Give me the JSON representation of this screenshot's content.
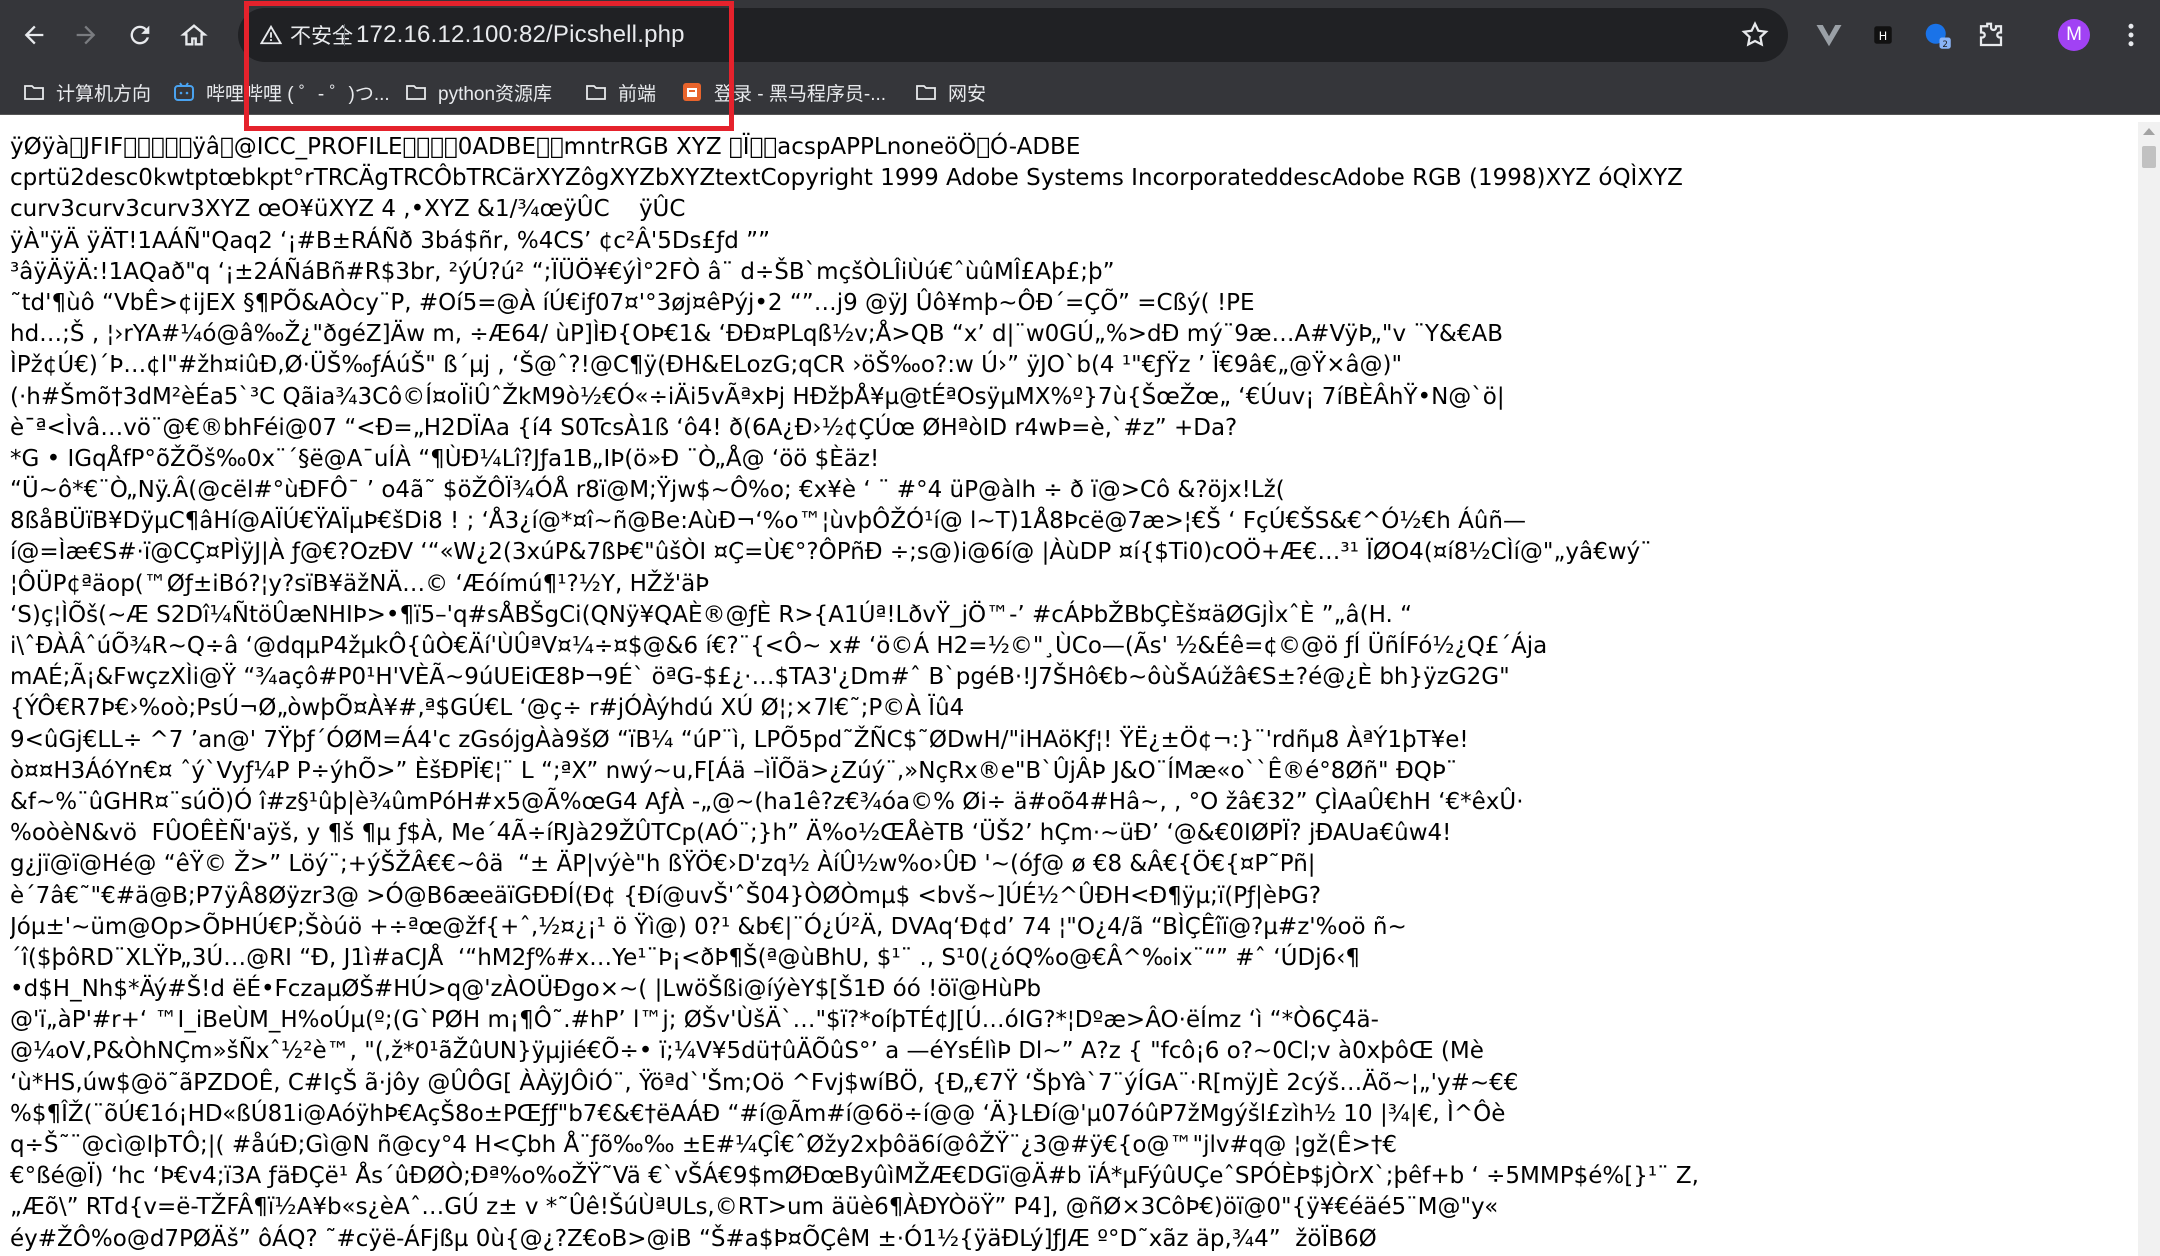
{
  "browser": {
    "security_label": "不安全",
    "url": "172.16.12.100:82/Picshell.php",
    "avatar_letter": "M",
    "accent_highlight": "#e5222c",
    "ext_badge": "2"
  },
  "bookmarks": [
    {
      "label": "计算机方向",
      "icon": "folder-icon"
    },
    {
      "label": "哔哩哔哩 ( ゜- ゜)つ...",
      "icon": "bilibili-icon"
    },
    {
      "label": "python资源库",
      "icon": "folder-icon"
    },
    {
      "label": "前端",
      "icon": "folder-icon"
    },
    {
      "label": "登录 - 黑马程序员-...",
      "icon": "site-favicon-icon"
    },
    {
      "label": "网安",
      "icon": "folder-icon"
    }
  ],
  "content_lines": [
    "ÿØÿà\u0000JFIF\u0000\u0001\u0002\u0000\u0000ÿâ\u0002@ICC_PROFILE\u0000\u0001\u0001\u00000ADBE\u0002\u0010mntrRGB XYZ \u0007Ï\u0000\u0006acspAPPLnoneöÖ\u0000Ó-ADBE",
    "cprtü2desc\u0001\u00000kwtpt\u0001œ\u0014bkpt\u0001°\u0014rTRC\u0001Ä\u000egTRC\u0001Ô\u000ebTRC\u0001ä\u000erXYZ\u0001ô\u0014gXYZ\u0002\b\u0014bXYZ\u0002\u001c\u0014textCopyright 1999 Adobe Systems Incorporateddesc\u0011Adobe RGB (1998)XYZ óQ\u0001\u0001\u0016ÌXYZ",
    "curv\u0001\u00023curv\u0001\u00023curv\u0001\u00023XYZ œ\u0018O¥\u0004üXYZ 4\u0019 ,\u0007•XYZ &1\u0010/¾œÿÛC\u0001\u0001\u0001\u0001\u0001\u0001\u0001\u0001\u0001\u0001\u0001\u0001\u0001\u0001\u0001\u0001\u0001\u0001\u0001\u0001\u0001\u0001\u0001\u0001 \u0001\u0001\u0001\u0001\u0001\u0001\u0001\u0001 \u0001\u0001\u0001\u0001\u0001\u0001 \u0001 ÿÛC\u0001\u0001\u0001\u0001\u0001\u0001\u0001\u0001\u0001\u0001\u0001\u0001 \u0001\u0001\u0001",
    "ÿÀ\u0011\u0002\u0010\u0003\u0001\"\u0002\u0011\u0001\u0003\u0011\u0001ÿÄ\u001f\u0001\u0001\u0001\u0001\u0001\u0001\u0001\u0001\u0001\u0001\u0001\u0001\u0001\u0001\u0001 ÿÄT\u0001\u0001\u0001\u0001\u0001\u0001\u0001\u0001\u0001\u0001\u0001\u0001\u0001\u0001\u0001\u0001\u0001\u0001\u0001\u0001\u0001\u0001\u0001\u0001\u0001\u0001\u0001\u0001\u0001\u0001\u0001!1A\u0002ÁÑ\"Q\u0003aq\u0013\u00072 ‘¡\u0014#B±RÁÑð \u00153bá$ñ\u0004r, %4CS’ ¢\u0010c²Â\u0010'5Ds£ƒd ””",
    "³âÿÄ\u001f\u0001\u0001\u0001\u0001\u0001\u0001\u0001\u0001\u0001\u0001\u0001\u0001\u0001\u0001\u0001ÿÄ:\u0011\u0001\u0001\u0001\u0001\u0001\u0001\u0001\u0001\u0001\u0001\u0001\u0001\u0001\u0001\u0001\u0001\u0001!\u00011A\u0002\u0011Qað\u0013\u0003\"q\u0012 ‘¡±\u0011\u00142ÁÑá\u0015Bñ#R\u0003\u0016$3br, ²ýÚ\u0001\u0001\u0001\u0001\u0001\u0001\u0001\u0001?ú² “;ÏÜÖ¥€ýÌ\u0003°2FÒ\u0001\u0001 â¨ d÷ŠB`mçšÒLÎ\u0002iÙú€ˆùûMÎ\u0001£Aþ£;þ”",
    "˜td'¶ùô “VbÊ>¢\u0001\u0001\u0016ijEX\u0001\u0001 §¶PÕ\u0001&AÒcy¨P, #Oí5=@À\u0001 íÚ€iƒ07¤'°\u0001\u0001\u00063\u0001øj\u0001¤\u0001êPýj•\u0001\u00012 “”…\u0001j9 @ÿJ\u0001 \u0001Ûô¥\u0001mþ~ÔÐ´\u0001=ÇÕ” =Cßý(\u0001 !PE",
    "hd…\u0001;Š\u0001 , \u0001¦›rYA#¼ó@â‰Ž¿\u0001\"\u0001\u0001ðgéZ]Ä\u0001w m, ÷Æ64/\u0001 ùP\u0001\u0001]ÌÐ\u0001\u0001{OÞ€1& ‘ÐÐ\u0001\u0001\u0001¤P\u0001Lqß½v;Å\u0001>QB “x’ d|¨\u0001w0GÚ„%\u0001>dÐ\u0001 mý¨\u00019æ…A#VÿÞ„\"v \u0001¨Y&€\u0001\u0001\u0001A\u0001\u0001\u0001B",
    "ÌPž¢\u0001Ú€\u0001)´\u0001Þ…¢l\"#žh\u0001\u0001¤i\u0001ûÐ‚Ø\u0001·ÜŠ\u0001‰ƒÁúŠ\u0001\" \u0001ß´\u0001µ\u0001\u0001\u0001j , ‘Š\u0001@\u0001ˆ?!@C¶ÿ(\u0001Ð\u0001H&E\u0001L\u0001oz\u0001G;qCR ›öŠ\u0001‰o?:\u0001\u0001\u0001\u0001\u0001w \u0001Ú›” \u0001\u0001ÿJ\u0001O`b(4 ¹\"€ƒŸz\u0001\u0001\u0001 ’ \u0001Ï€\u00019â€„@Ÿ×â@)\"",
    "(\u0001·\u0001h#Šmõ†3dM²èÉa5`³C Qãi\u0001a\u0001¾3Cô©Í¤oÏiÛ\u0001ˆŽkM9\u0001\u0001\u0001ò½€Ó«÷iÄi5vÃ\u0001ªxÞj HÐžþÅ¥µ@tÉ\u0001ªOsÿµMX%º}7ù{Šœ\u0001Žœ„ ‘€Úuv¡ 7íBÈÂ\u0001\u0001\u0001h\u0001\u0001\u0001Ÿ•N@`ö\u0001|",
    "è\u0001\u0001¯ª\u0001<Ìvâ…\u0001vö\u0001¨@€®bh\u0001\u0001Féi@07 “<Ð=„H2DÏ\u0001Aa\u0001 {í4 S0TcsÀ\u0001\u0001\u00011ß ‘ô4\u0001!\u0001 ð(6A¿Ð›\u0001\u0001\u0001\u0001½\u0001¢\u0001ÇÚœ \u0001ØH\u0001ªòID r4\u0001wÞ=è,`#z\u0001” +D\u0001a?",
    "*\u0001\u0001\u0001\u0001\u0001\u0001G •\u0001\u0001\u0001\u0001 I\u0001GqÅfP°\u0001õŽÕ\u0001\u0001\u0001š‰0x¨\u0001´\u0001§ë@A¯uÍ\u0001\u0001\u0001À “¶ÙÐ¼\u0001Lî?\u0001Jƒa1B„IÞ(\u0001\u0001ö\u0001»Ð \u0001¨\u0001Ò„\u0001\u0001Å@ ‘öö $\u0001Èäz\u0001!",
    " “Ü~ô*€\u0001\u0001¨Ò„\u0001Nÿ.Â(@\u0001cël\u0001#°ùÐ\u0001\u0001FÔ\u0001¯ ’ o4\u0001ã˜ $öŽÔ\u0001Ï¾ÓÅ\u0001 r8ï@M;\u0001\u0001Ÿj\u0001w$~Ô%o; €x\u0001\u0001¥\u0001\u0001\u0001è\u0001 ‘ ¨ \u0001#°4\u0001\u0001 üP\u0001@àlh ÷ \u0001ð ï@\u0001>Cô &\u0001?öjx!Lž(",
    "\u00018ßåB\u0001ÜïB¥D\u0001\u0001ÿµ\u0001C¶âHí@AÏÚ€ŸAÏµ\u0001Þ€šDi8 ! ; ‘Å\u0001\u00013¿í@*¤î~ñ@B\u0001e:AùÐ¬‘%o™¦\u0001ùvþÔ\u0001ŽÓ¹í@\u0001\u0001 l~T)\u0001\u00011Å\u00018Þcë@\u00017æ>¦€Š ‘ FçÚ€ŠS&€^Ó\u0001½\u0001\u0001€h Áûñ\u0001\u0001\u0001—",
    "í@\u0001=Ìæ€S#·ï@CÇ¤PÌÿJ\u0001|À \u0001\u0001ƒ@€\u0001\u0001?OzÐV ‘“«W¿2(\u00013\u0001xúP\u0001&7ßÞ€\u0001\"ûšÒI ¤Ç=Ù€°?ÔPñÐ ÷;s@)\u0001i@\u00016í@ |ÀùDP ¤í{$Ti0)\u0001cOÖ+\u0001\u0001Æ€…³¹ \u0001ÏØO4(¤í\u00018\u0001½\u0001CÌ\u0001í@\"„\u0001yâ€wý¨",
    "¦Ô\u0001ÜP¢ª\u0001äop(\u0001™Ø\u0001ƒ±iBó?¦y?sïB¥ä\u0001žNÄ…©\u0001 ‘Æóí\u0001mú¶\u0001¹?½Y, HŽ\u0001ž'äÞ",
    " ‘S)\u0001\u0001ç¦ÌÕš(~Æ \u0001S2Dî¼\u0001Ñt\u0001öÛæ\u0001NHIÞ>•\u0001\u0001\u0001\u0001¶ï5–\u0001'q#sÅBŠg\u0001Ci(\u0001Q\u0001Nÿ¥\u0001\u0001\u0001\u0001QAÈ\u0001\u0001®@ƒÈ \u0001R>{A1Úª!LðvŸ_jÖ™-’ #cÁÞbŽBbÇÈš¤ä\u0001ØGjÌxˆÈ ”„â(H. “",
    "\u0001\u0001i\\ˆÐÀÂˆúÕ¾R~Q÷â ‘@dqµP4žµkÔ\u0001{\u0001ûÒ€Äí'ÙÛªV¤\u0001¼\u0001÷¤$\u0001@&6\u0001 í€?¨{\u0001<Ô~ x# ‘ö©Á\u0001 H2=½©\"\u0001\u0001¸ÙCo—\u0001(Ãs' ½&É\u0001ê=\u0001\u0001\u0001¢©\u0001@ö \u0001ƒÍ \u0001ÜñÍFó½\u0001¿Q£´Ája\u0001",
    "mAÉ;Ã¡&F\u0001wçz\u0001XÌi@Ÿ\u0001 “¾açô\u0001#P0\u0001¹\u0001\u0001H'\u0001VÈÃ~9úUEiŒ8Þ¬9\u0001É\u0001` öªG-\u0001$\u0001£¿·\u0001…$TA3'¿\u0001\u0001Dm\u0001\u0001#ˆ\u0001 B`pgéB·!J7ŠHô\u0001\u0001€b~ô\u0001ùŠAúžâ€S±?é@\u0001¿È bh}ÿzG2G\u0001\"",
    "{ÝÔ€R7Þ€›%o\u0001ò;P\u0001\u0001sÚ¬Ø\u0001„òwþÕ¤À¥#‚ª\u0001\u0001$GÚ€\u0001L ‘@\u0001\u0001ç÷ \u0001r#j\u0001ÓÀýhdú\u0001 XÚ\u0001 Ø¦;×7l€˜;P©À\u0001 Ïû4",
    "9<\u0001ûGj\u0001\u0001€L\u0001\u0001L÷ ^7 ’an@\u0001' 7Ÿþƒ´ÓØM=Á4\u0001\u0001'c\u0001\u0001 z\u0001\u0001Gsój\u0001gÀ\u0001\u0001\u0001à9š\u0001\u0001Ø “ïB\u0001\u0001¼ “úP\u0001¨ì, LPÕ5\u0001pd˜ŽÑC$˜ØDw\u0001H/\"i\u0001H\u0001AöKƒ¦! ŸË¿±\u0001Ö¢¬:\u0001}¨'rdñµ8 ÀªÝ1þT¥e!\u0001",
    "\u0001ò¤\u0001¤\u0001H3ÁóYn€¤ ˆý`Vy\u0001ƒ¼P P÷ýh\u0001Õ>” ÈšÐP\u0001\u0001\u0001\u0001\u0001\u0001Ï\u0001€¦¨ L “;ªX” \u0001nw\u0001ý~u,F[\u0001Áä –ìÏÕä\u0001>¿Z\u0001\u0001úý¨,»NçRx®e\"B`Ûj\u0001Â\u0001Þ J\u0001&O¨ÍM\u0001æ«o`\u0001`Ê®é°8\u0001Øñ\u0001\" Ð\u0001\u0001\u0001QÞ¨",
    "&f~%¨ûG\u0001HR¤¨súÖ)\u0001Ó î#z\u0001§¹ûþ|è\u0001\u0001¾ûmP\u0001\u0001óH\u0001\u0001\u0001#x5@Ã%œG4 AƒÀ -„@\u0001~(ha1ê?z\u0001€\u0001¾ó\u0001a\u0001©% \u0001Øi÷ ä#oõ4#\u0001Hâ~, , \u0001°\u0001O žâ€32” ÇÌ\u0001AaÛ€hH ‘€\u0001*\u0001ê\u0001\u0001xÛ·",
    "%oò\u0001èN\u0001&vö \u0001 FÛOÊ\u0001ÈÑ'aÿš\u0001, y \u0001\u0001¶š\u0001\u0001 ¶\u0001µ ƒ$À, Me´4Ã÷íRJà29ŽÛT\u0001C\u0001p(AÓ¨\u0001;}h\u0001” Ä%o\u0001½\u0001Œ\u0001Å\u0001èTB ‘ÜŠ\u00012’ h\u0001\u0001Çm·\u0001\u0001\u0001\u0001~üÐ\u0001’ ‘@\u0001\u0001\u0001\u0001&€0IØP\u0001Ï? jÐA\u0001U\u0001a€\u0001ûw4!",
    "g\u0001¿jï@\u0001\u0001ï@H\u0001\u0001é@\u0001 “êŸ© \u0001\u0001Ž>” \u0001Löý¨\u0001;+ýŠ\u0001ŽÂ€€~ô\u0001ä \u0001 “± \u0001ÄP\u0001|výè\u0001\u0001\u0001\"h ßŸÖ€›D\u0001'z\u0001q½\u0001 ÀíÛ½w%o›ÛÐ \u0001'~(\u0001óƒ@ ø \u0001€8 &Â€{\u0001Ö€\u0001{\u0001¤P˜Pñ\u0001|",
    "è\u0001´7â€˜\"€\u0001#ä@B;P\u00017ÿÂ\u00018Ø\u0001ÿzr3@ >Ó@B6æeä\u0001ïGÐÐ\u0001Í(Ð¢ {Ðí@\u0001uvŠ\u0001\u0001'ˆŠ\u000104}\u0001ÒØ\u0001\u0001\u0001Òm\u0001µ$ <bvš\u0001~]\u0001ÚÉ\u0001½^ÛÐH<Ð\u0001¶ÿµ\u0001;ï(\u0001Pƒ\u0001|è\u0001ÞG?",
    "Jóµ±'~üm@Op>ÕÞHÚ€P;Š\u0001òúö \u0001\u0001\u0001+÷ªœ\u0001@žf{+ˆ,\u0001\u0001½¤\u0001¿¡¹ \u0001ö \u0001\u0001Ÿì@) 0?¹ \u0001&b€\u0001|¨\u0001Ó¿Ú²Ä\u0001, D\u0001\u0001\u0001VA\u0001q‘Ð¢\u0001d’ 74 ¦\"O¿4/ã “BÌÇÊîï@\u0001\u0001?\u0001\u0001µ#z\u0001'%oö \u0001\u0001ñ~",
    "´\u0001î(\u0001$\u0001þôRD\u0001¨X\u0001L\u0001ŸÞ„\u00013Ú…@RI\u0001 “\u0001Ð, \u0001J1ì#aCJÅ \u0001 ‘“hM2\u0001ƒ%#x\u0001…Ye¹¨\u0001Þ¡<ðÞ¶Š(\u0001ª@ù\u0001\u0001BhU, $\u0001¹¨ ., S¹0(\u0001\u0001\u0001¿ó\u0001Q%o\u0001@\u0001€Â^\u0001‰\u0001ix¨“” \u0001#ˆ ‘ÚD\u0001j6‹¶\u0001",
    " •d$\u0001H\u0001_Nh$*\u0001Äý#Š\u0001!\u0001d ë\u0001É•Fcz\u0001aµ\u0001\u0001ØŠ\u0001#HÚ>q@\u0001'zÀ\u0001OÜÐ\u0001go×~( |LwöŠ\u0001\u0001\u0001\u0001ßi@\u0001íýèY$[Š\u00011Ð\u0001\u0001 óó !öï@\u0001HùP\u0001b",
    "\u0001@\u0001'ï„àP\u0001'#r+‘ ™I\u0001_\u0001iBeÙM_H%oÚµ(º\u0001;\u0001(G`PØH m¡\u0001¶Ô˜\u0001.#h\u0001P’ l™\u0001\u0001j; ØŠ\u0001v'Ù\u0001šÄ`…\"$ï?*oíþT\u0001É¢J[\u0001Ú…\u0001óIG?*\u0001¦D\u0001ºæ\u0001>ÂO·ëÍmz ‘\u0001ì “*Ò6\u0001Ç4ä-",
    "@¼oV,P&\u0001\u0001ÒhN\u0001Çm»š\u0001Ñxˆ\u0001½²è™, \u0001\"(\u0001\u0001,ž*0\u0001¹ãŽûUN\u0001}ÿµjié€Õ\u0001\u0001\u0001÷• ï;\u0001¼V¥5dü†ûÄÕûS°’ a\u0001 —éYsÉ\u0001lìÞ \u0001Dl~” \u0001A\u0001?z\u0001 { \u0001\"fcô¡6\u0001 o?~0Cl;v à0xþô\u0001\u0001Œ\u0001 \u0001(Mè",
    " ‘ù\u0001\u0001*\u0001HS‚úw\u0001\u0001$\u0001@ö˜ãPZ\u0001DOÊ, C\u0001#IçŠ\u0001\u0001 ã·j\u0001\u0001\u0001ôy @ÛÔG\u0001[ ÀÀÿJÔiÓ¨, \u0001Ÿöªd`'Š\u0001m;Oö ^F\u0001vj\u0001$wíBÖ\u0001, {Ð„€7Ÿ ‘ŠþYà`7¨ýÍG\u0001A¨\u0001·\u0001R[\u0001\u0001mÿJ\u0001È 2cýš…\u0001Äõ~¦„\u0001'y#~€€",
    "%$\u0001¶ÎŽ(\u0001\u0001¨õÚ€1ó¡HD«ßÚ\u0001\u00018\u00011i@AóÿhÞ\u0001\u0001\u0001\u0001€AçŠ\u0001\u00018\u0001o±\u0001PŒƒƒ\"\u0001b7\u0001€&€†ëAÁÐ “#í@Ãm#í@\u0001\u00016ö÷í@@ ‘Ä}LÐ\u0001\u0001\u0001í@\u0001'µ07óû\u0001P\u00017žMgýš\u0001\u0001l\u0001\u0001£z\u0001\u0001\u0001\u0001\u0001ìh\u0001\u0001\u0001½\u0001 \u000110 \u0001|¾|€, Ì^Ôè",
    "\u0001q÷Š˜\u0001¨\u0001@\u0001cì@\u0001I\u0001þT\u0001Ô\u0001;|( #åúÐ\u0001;Gì@N ñ@cy\u0001\u0001\u0001°4\u0001 H<Çbh Å\u0001\u0001¨ƒõ‰‰ \u0001±\u0001E#¼ÇÎ€ˆØžy\u0001\u0001\u00012xþô\u0001\u0001\u0001ä6í@\u0001ôŽŸ¨\u0001\u0001¿3@\u0001#ÿ\u0001€\u0001{o@\u0001™\"\u0001jlv#q@ ¦gž(\u0001\u0001\u0001Ê>†€",
    "€\u0001°ßé@\u0001Ï\u0001\u0001) ‘\u0001hc ‘Þ€\u0001v4;ï3A ƒäÐ\u0001\u0001\u0001Çë¹ \u0001Ås´ûÐ\u0001Ø\u0001\u0001Ò\u0001\u0001;Ðª%o%oŽŸ˜Vä \u0001€`vŠ\u0001Á€9$mØÐœ\u0001ByûìMŽÆ€\u0001DG\u0001ï@Ä#b ïÁ\u0001*µFýûUÇeˆSPÓÈÞ$jÒrX`;þêf+b\u0001 ‘ ÷5MMP$é%[}¹¨ Z\u0001,",
    "„Æõ\u0001\\” RTd{v=ë-TŽFÂ¶ï½A¥b«s¿èAˆ…G\u0001Ú z\u0001± v *˜Ûê!Š\u0001\u0001\u0001\u0001úÙª\u0001\u0001\u0001ULs,\u0001©R\u0001T\u0001\u0001>um\u0001 \u0001äüè6\u0001¶ÀÐYÒöŸ” P4], @ñ\u0001Ø×3CôÞ€)öï@\u00010\"{ÿ¥€\u0001\u0001éäé5¨M@\u0001\"y«",
    "éy#ŽÔ%o@d7PØ\u0001Äš” ôÁQ? ˜#cÿë-Á\u0001\u0001\u0001Fjßµ 0ù\u0001{\u0001@\u0001\u0001¿?Z\u0001€oB\u0001>@iB “Š\u0001#a$Þ\u0001\u0001¤\u0001ÕÇêM ±·Ó1½{ÿä\u0001Ð\u0001Lý]ƒJÆ\u0001 º°D˜\u0001xãz äp\u0001\u0001,\u0001¾4” \u0001 žöÏB\u00016Ø"
  ]
}
